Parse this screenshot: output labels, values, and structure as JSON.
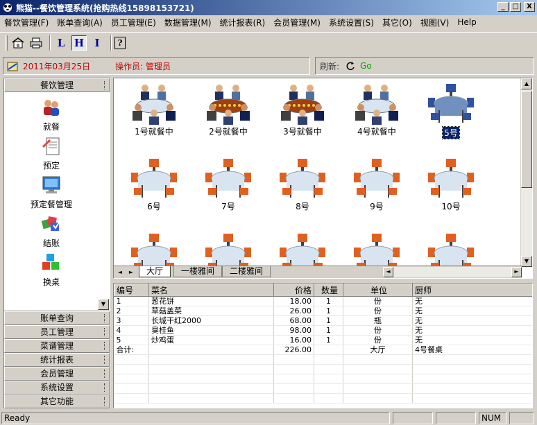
{
  "window": {
    "title": "熊猫--餐饮管理系统(抢购热线15898153721)",
    "buttons": {
      "minimize": "_",
      "maximize": "□",
      "close": "X"
    }
  },
  "menu": [
    {
      "label": "餐饮管理(F)"
    },
    {
      "label": "账单查询(A)"
    },
    {
      "label": "员工管理(E)"
    },
    {
      "label": "数据管理(M)"
    },
    {
      "label": "统计报表(R)"
    },
    {
      "label": "会员管理(M)"
    },
    {
      "label": "系统设置(S)"
    },
    {
      "label": "其它(O)"
    },
    {
      "label": "视图(V)"
    },
    {
      "label": "Help"
    }
  ],
  "toolbar": {
    "L": "L",
    "H": "H",
    "I": "I",
    "help": "?"
  },
  "info": {
    "date": "2011年03月25日",
    "operator": "操作员: 管理员",
    "refresh_label": "刷新:",
    "go": "Go"
  },
  "sidebar": {
    "active_section": "餐饮管理",
    "items": [
      {
        "label": "就餐",
        "icon": "diners-icon"
      },
      {
        "label": "预定",
        "icon": "reservation-icon"
      },
      {
        "label": "预定餐管理",
        "icon": "monitor-icon"
      },
      {
        "label": "结账",
        "icon": "checkout-icon"
      },
      {
        "label": "换桌",
        "icon": "cubes-icon"
      }
    ],
    "sections": [
      "账单查询",
      "员工管理",
      "菜谱管理",
      "统计报表",
      "会员管理",
      "系统设置",
      "其它功能"
    ]
  },
  "tables": [
    {
      "label": "1号就餐中",
      "state": "occupied"
    },
    {
      "label": "2号就餐中",
      "state": "occupied"
    },
    {
      "label": "3号就餐中",
      "state": "occupied"
    },
    {
      "label": "4号就餐中",
      "state": "occupied"
    },
    {
      "label": "5号",
      "state": "selected"
    },
    {
      "label": "6号",
      "state": "empty"
    },
    {
      "label": "7号",
      "state": "empty"
    },
    {
      "label": "8号",
      "state": "empty"
    },
    {
      "label": "9号",
      "state": "empty"
    },
    {
      "label": "10号",
      "state": "empty"
    },
    {
      "label": "",
      "state": "empty"
    },
    {
      "label": "",
      "state": "empty"
    },
    {
      "label": "",
      "state": "empty"
    },
    {
      "label": "",
      "state": "empty"
    },
    {
      "label": "",
      "state": "empty"
    }
  ],
  "tabs": [
    "大厅",
    "一楼雅间",
    "二楼雅间"
  ],
  "order": {
    "columns": [
      "编号",
      "菜名",
      "价格",
      "数量",
      "单位",
      "厨师"
    ],
    "rows": [
      {
        "no": "1",
        "name": "葱花饼",
        "price": "18.00",
        "qty": "1",
        "unit": "份",
        "chef": "无"
      },
      {
        "no": "2",
        "name": "草菇盖菜",
        "price": "26.00",
        "qty": "1",
        "unit": "份",
        "chef": "无"
      },
      {
        "no": "3",
        "name": "长城干红2000",
        "price": "68.00",
        "qty": "1",
        "unit": "瓶",
        "chef": "无"
      },
      {
        "no": "4",
        "name": "臭桂鱼",
        "price": "98.00",
        "qty": "1",
        "unit": "份",
        "chef": "无"
      },
      {
        "no": "5",
        "name": "炒鸡蛋",
        "price": "16.00",
        "qty": "1",
        "unit": "份",
        "chef": "无"
      }
    ],
    "total": {
      "label": "合计:",
      "price": "226.00",
      "area": "大厅",
      "table": "4号餐桌"
    }
  },
  "status": {
    "text": "Ready",
    "num": "NUM"
  }
}
